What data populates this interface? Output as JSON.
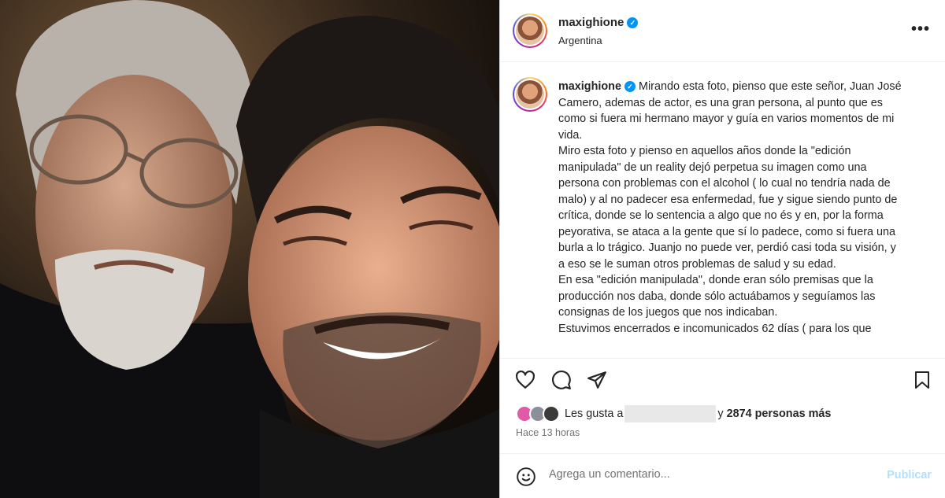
{
  "post": {
    "username": "maxighione",
    "verified": true,
    "location": "Argentina",
    "more_icon": "more-horizontal-icon"
  },
  "caption": {
    "username": "maxighione",
    "paragraphs": [
      "Mirando esta foto, pienso que este señor, Juan José Camero, ademas de actor, es una gran persona, al punto que es como si fuera mi hermano mayor y guía en varios momentos de mi vida.",
      "Miro esta foto y pienso en aquellos años donde la \"edición manipulada\" de un reality dejó perpetua su imagen como una persona con problemas con el alcohol ( lo cual no tendría nada de malo) y al no padecer esa enfermedad, fue y sigue siendo punto de crítica, donde se lo sentencia a algo que no és y en, por la forma peyorativa, se ataca a la gente que sí lo padece, como si fuera una burla a lo trágico. Juanjo no puede ver, perdió casi toda su visión, y a eso se le suman otros problemas de salud y su edad.",
      "En esa \"edición manipulada\", donde eran sólo premisas que la producción nos daba, donde sólo actuábamos y seguíamos las consignas de los juegos que nos indicaban.",
      "Estuvimos encerrados e incomunicados 62 días ( para los que"
    ]
  },
  "actions": {
    "like_icon": "heart-icon",
    "comment_icon": "comment-icon",
    "share_icon": "share-icon",
    "save_icon": "bookmark-icon"
  },
  "likes": {
    "prefix": "Les gusta a",
    "connector": "y",
    "count_text": "2874 personas más"
  },
  "time_ago": "Hace 13 horas",
  "comment": {
    "emoji_icon": "emoji-icon",
    "placeholder": "Agrega un comentario...",
    "publish_label": "Publicar"
  },
  "colors": {
    "verified": "#0095f6",
    "publish_disabled": "#b2dffc",
    "secondary_text": "#737373"
  }
}
